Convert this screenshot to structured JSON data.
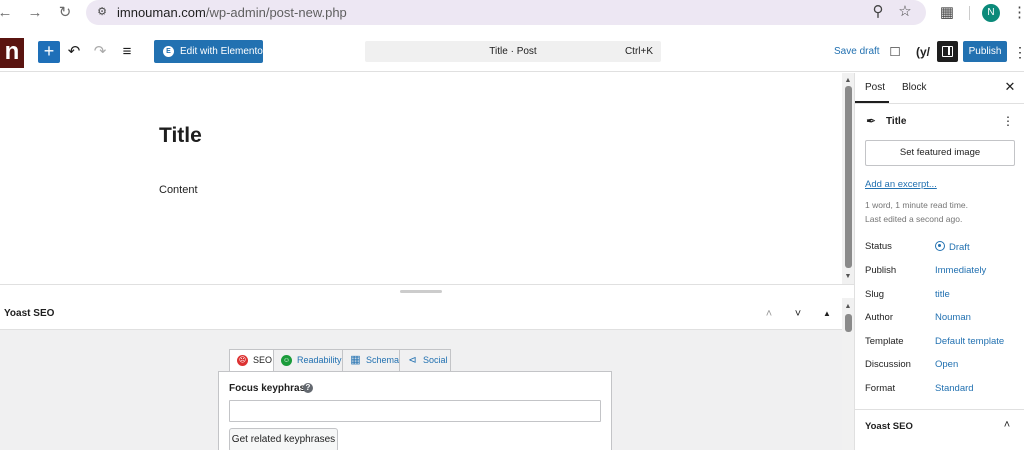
{
  "browser": {
    "url_host": "imnouman.com",
    "url_path": "/wp-admin/post-new.php",
    "profile_initial": "N"
  },
  "toolbar": {
    "site_logo_letter": "n",
    "elementor_label": "Edit with Elementor",
    "command_title": "Title · Post",
    "command_shortcut": "Ctrl+K",
    "save_draft_label": "Save draft",
    "yoast_label": "(y/",
    "publish_label": "Publish"
  },
  "editor": {
    "post_title": "Title",
    "post_content": "Content"
  },
  "yoast_panel": {
    "title": "Yoast SEO",
    "tabs": [
      {
        "label": "SEO",
        "color": "#dc3232"
      },
      {
        "label": "Readability",
        "color": "#1a9b3a"
      },
      {
        "label": "Schema",
        "color": "#2271b1"
      },
      {
        "label": "Social",
        "color": "#2271b1"
      }
    ],
    "focus_keyphrase_label": "Focus keyphrase",
    "focus_keyphrase_value": "",
    "help_glyph": "?",
    "related_button_label": "Get related keyphrases"
  },
  "sidebar": {
    "tabs": [
      {
        "label": "Post"
      },
      {
        "label": "Block"
      }
    ],
    "doc_title": "Title",
    "featured_image_label": "Set featured image",
    "excerpt_link": "Add an excerpt...",
    "read_time": "1 word, 1 minute read time.",
    "last_edited": "Last edited a second ago.",
    "properties": [
      {
        "label": "Status",
        "value": "Draft"
      },
      {
        "label": "Publish",
        "value": "Immediately"
      },
      {
        "label": "Slug",
        "value": "title"
      },
      {
        "label": "Author",
        "value": "Nouman"
      },
      {
        "label": "Template",
        "value": "Default template"
      },
      {
        "label": "Discussion",
        "value": "Open"
      },
      {
        "label": "Format",
        "value": "Standard"
      }
    ],
    "yoast_section_title": "Yoast SEO"
  },
  "colors": {
    "wp_blue": "#2271b1",
    "add_block_blue": "#1e6fb8",
    "site_logo_bg": "#5a1410",
    "url_bar_bg": "#ede7f3"
  }
}
